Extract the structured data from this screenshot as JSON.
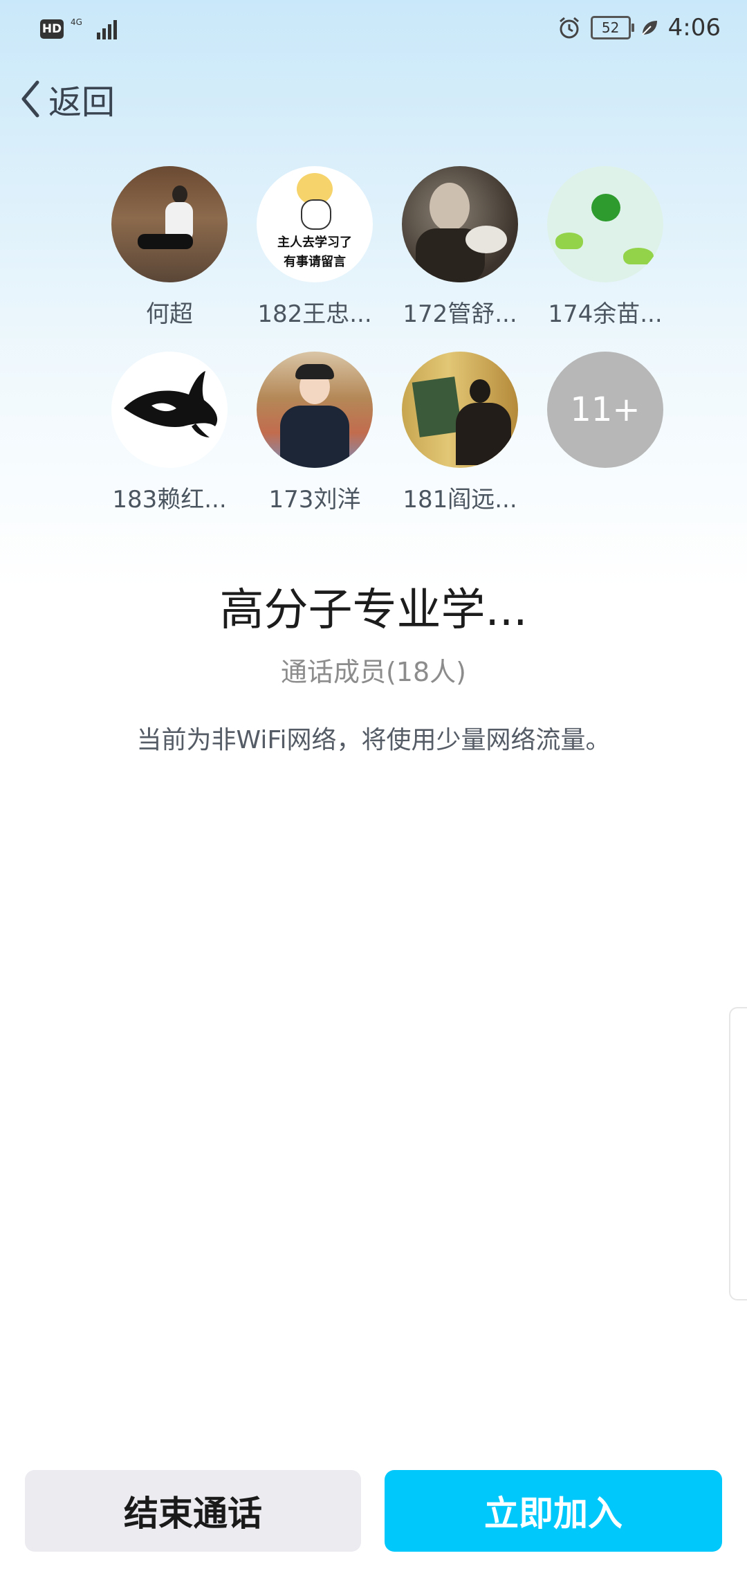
{
  "status_bar": {
    "hd": "HD",
    "network": "4G",
    "battery": "52",
    "time": "4:06"
  },
  "nav": {
    "back_label": "返回"
  },
  "members": [
    {
      "name": "何超"
    },
    {
      "name": "182王忠..."
    },
    {
      "name": "172管舒..."
    },
    {
      "name": "174余苗..."
    },
    {
      "name": "183赖红..."
    },
    {
      "name": "173刘洋"
    },
    {
      "name": "181阎远..."
    }
  ],
  "avatar_texts": {
    "cat_line1": "主人去学习了",
    "cat_line2": "有事请留言"
  },
  "more_members": "11+",
  "call": {
    "title": "高分子专业学...",
    "count": "通话成员(18人)",
    "network_hint": "当前为非WiFi网络，将使用少量网络流量。"
  },
  "actions": {
    "end_label": "结束通话",
    "join_label": "立即加入"
  }
}
